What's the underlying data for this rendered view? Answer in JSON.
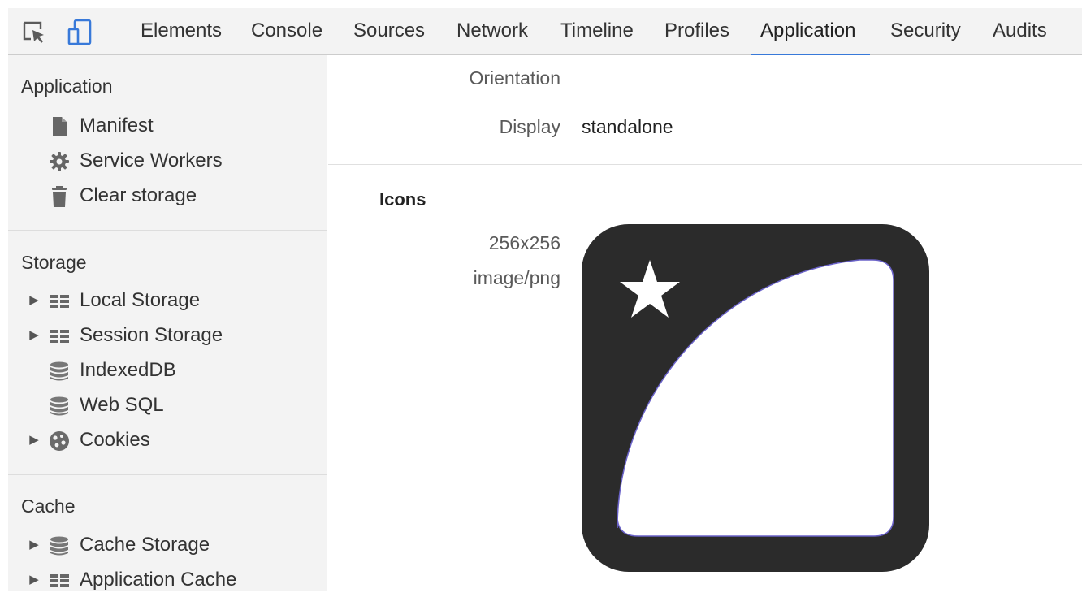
{
  "toolbar": {
    "tabs": [
      {
        "label": "Elements"
      },
      {
        "label": "Console"
      },
      {
        "label": "Sources"
      },
      {
        "label": "Network"
      },
      {
        "label": "Timeline"
      },
      {
        "label": "Profiles"
      },
      {
        "label": "Application",
        "active": true
      },
      {
        "label": "Security"
      },
      {
        "label": "Audits"
      }
    ],
    "icons": [
      "inspect-element-icon",
      "device-mode-icon"
    ]
  },
  "sidebar": {
    "application": {
      "title": "Application",
      "items": [
        {
          "label": "Manifest",
          "icon": "document-icon"
        },
        {
          "label": "Service Workers",
          "icon": "gear-icon"
        },
        {
          "label": "Clear storage",
          "icon": "trash-icon"
        }
      ]
    },
    "storage": {
      "title": "Storage",
      "items": [
        {
          "label": "Local Storage",
          "icon": "grid-icon",
          "expandable": true
        },
        {
          "label": "Session Storage",
          "icon": "grid-icon",
          "expandable": true
        },
        {
          "label": "IndexedDB",
          "icon": "database-icon",
          "expandable": false
        },
        {
          "label": "Web SQL",
          "icon": "database-icon",
          "expandable": false
        },
        {
          "label": "Cookies",
          "icon": "cookie-icon",
          "expandable": true
        }
      ]
    },
    "cache": {
      "title": "Cache",
      "items": [
        {
          "label": "Cache Storage",
          "icon": "database-icon",
          "expandable": true
        },
        {
          "label": "Application Cache",
          "icon": "grid-icon",
          "expandable": true
        }
      ]
    },
    "arrow": "▶"
  },
  "manifest": {
    "orientation": {
      "label": "Orientation",
      "value": ""
    },
    "display": {
      "label": "Display",
      "value": "standalone"
    },
    "icons": {
      "title": "Icons",
      "size": "256x256",
      "type": "image/png"
    }
  },
  "colors": {
    "accent": "#3879d9",
    "sidebar_bg": "#f3f3f3",
    "icon_dark": "#2b2b2b"
  }
}
